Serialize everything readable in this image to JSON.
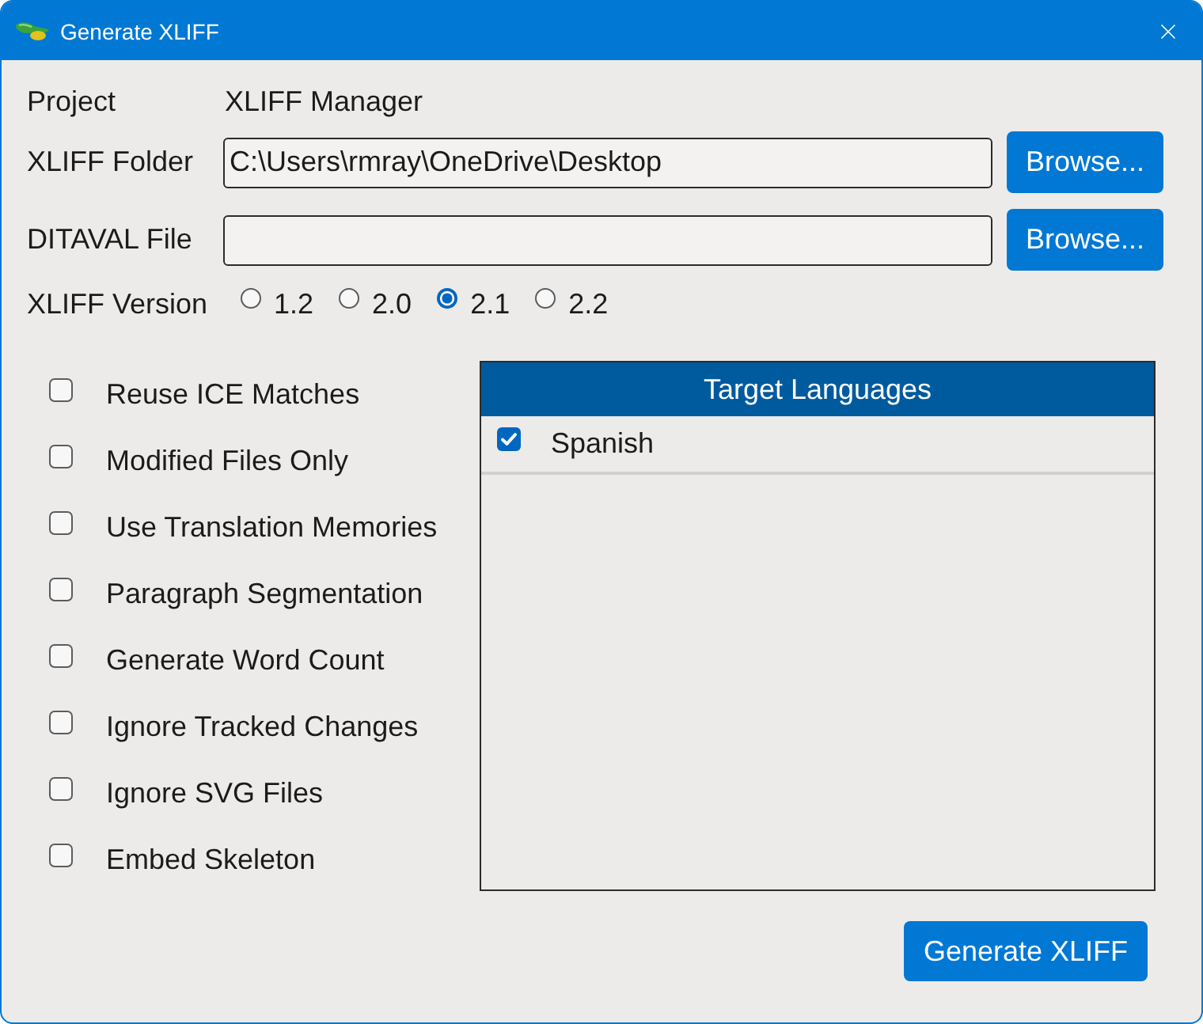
{
  "window": {
    "title": "Generate XLIFF"
  },
  "project": {
    "label": "Project",
    "value": "XLIFF Manager"
  },
  "xliff_folder": {
    "label": "XLIFF Folder",
    "value": "C:\\Users\\rmray\\OneDrive\\Desktop",
    "button": "Browse..."
  },
  "ditaval_file": {
    "label": "DITAVAL File",
    "button": "Browse..."
  },
  "xliff_version": {
    "label": "XLIFF Version",
    "options": [
      {
        "label": "1.2",
        "selected": false
      },
      {
        "label": "2.0",
        "selected": false
      },
      {
        "label": "2.1",
        "selected": true
      },
      {
        "label": "2.2",
        "selected": false
      }
    ]
  },
  "options": [
    {
      "label": "Reuse ICE Matches",
      "checked": false
    },
    {
      "label": "Modified Files Only",
      "checked": false
    },
    {
      "label": "Use Translation Memories",
      "checked": false
    },
    {
      "label": "Paragraph Segmentation",
      "checked": false
    },
    {
      "label": "Generate Word Count",
      "checked": false
    },
    {
      "label": "Ignore Tracked Changes",
      "checked": false
    },
    {
      "label": "Ignore SVG Files",
      "checked": false
    },
    {
      "label": "Embed Skeleton",
      "checked": false
    }
  ],
  "target_languages": {
    "title": "Target Languages",
    "items": [
      {
        "label": "Spanish",
        "checked": true
      }
    ]
  },
  "generate_button": "Generate XLIFF"
}
